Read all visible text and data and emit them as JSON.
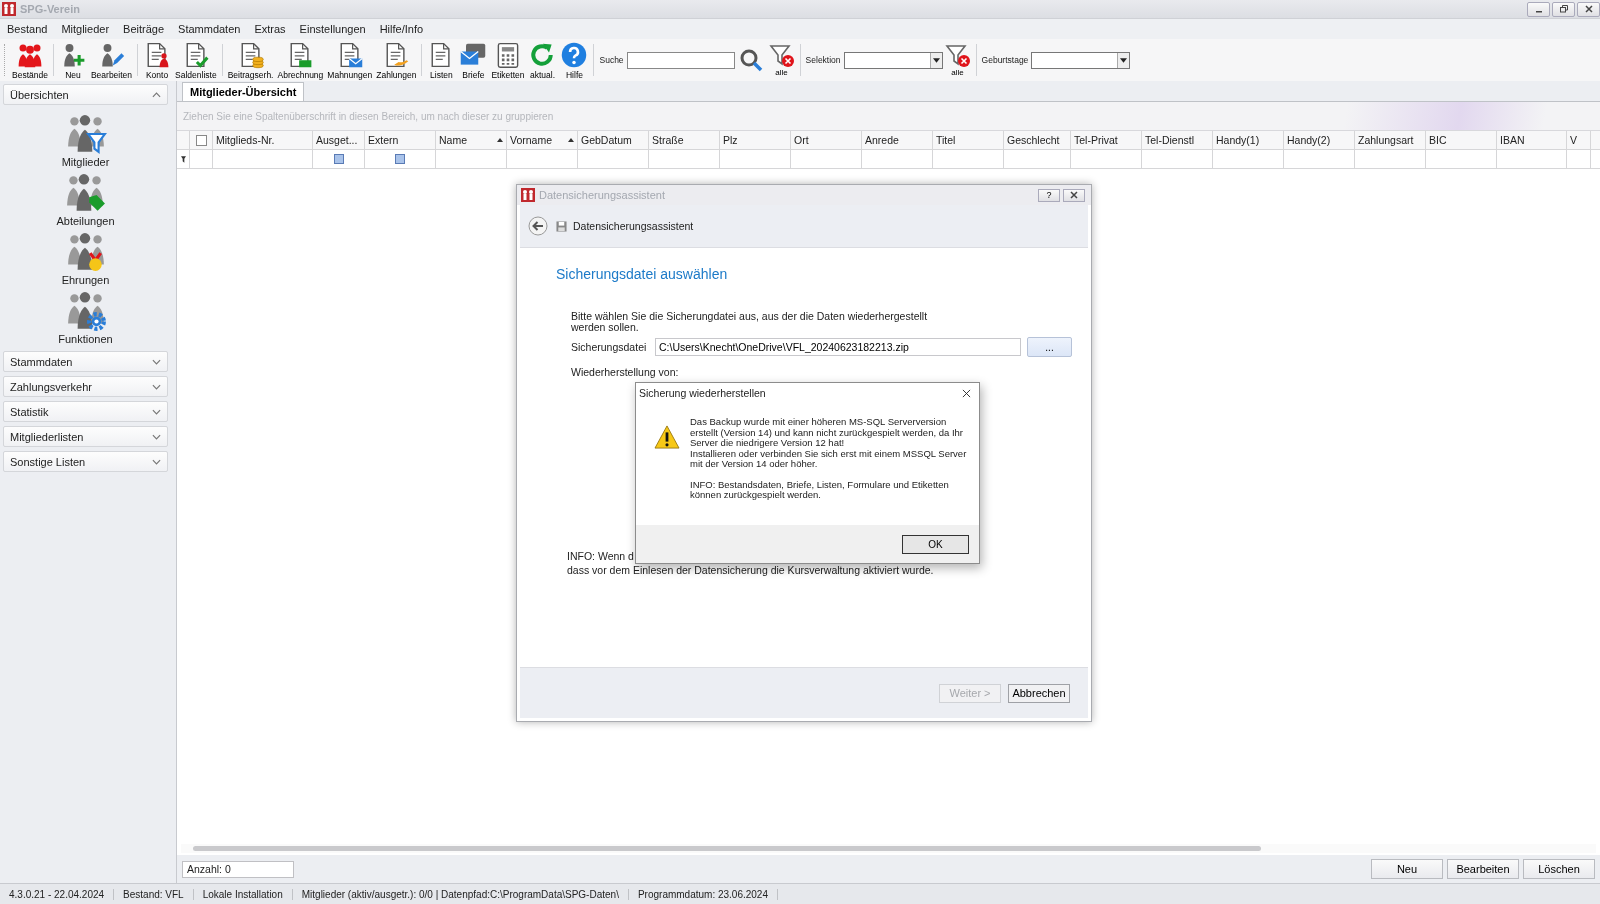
{
  "window": {
    "title": "SPG-Verein"
  },
  "menu": [
    "Bestand",
    "Mitglieder",
    "Beiträge",
    "Stammdaten",
    "Extras",
    "Einstellungen",
    "Hilfe/Info"
  ],
  "toolbar": {
    "groups": [
      [
        {
          "label": "Bestände",
          "kind": "pawns"
        }
      ],
      [
        {
          "label": "Neu",
          "kind": "person-plus"
        },
        {
          "label": "Bearbeiten",
          "kind": "person-pen"
        }
      ],
      [
        {
          "label": "Konto",
          "kind": "doc-person"
        },
        {
          "label": "Saldenliste",
          "kind": "doc-check"
        }
      ],
      [
        {
          "label": "Beitragserh.",
          "kind": "doc-coins"
        },
        {
          "label": "Abrechnung",
          "kind": "doc-list"
        },
        {
          "label": "Mahnungen",
          "kind": "doc-mail"
        },
        {
          "label": "Zahlungen",
          "kind": "doc-hand"
        }
      ],
      [
        {
          "label": "Listen",
          "kind": "doc"
        },
        {
          "label": "Briefe",
          "kind": "mail"
        },
        {
          "label": "Etiketten",
          "kind": "grid"
        },
        {
          "label": "aktual.",
          "kind": "refresh"
        },
        {
          "label": "Hilfe",
          "kind": "help"
        }
      ]
    ],
    "search_label": "Suche",
    "search_reset_label": "alle",
    "selection_label": "Selektion",
    "selection_reset_label": "alle",
    "birthdays_label": "Geburtstage"
  },
  "sidebar": {
    "sections": [
      {
        "title": "Übersichten",
        "expanded": true,
        "items": [
          {
            "label": "Mitglieder",
            "kind": "filter"
          },
          {
            "label": "Abteilungen",
            "kind": "tag"
          },
          {
            "label": "Ehrungen",
            "kind": "medal"
          },
          {
            "label": "Funktionen",
            "kind": "gear"
          }
        ]
      },
      {
        "title": "Stammdaten",
        "expanded": false
      },
      {
        "title": "Zahlungsverkehr",
        "expanded": false
      },
      {
        "title": "Statistik",
        "expanded": false
      },
      {
        "title": "Mitgliederlisten",
        "expanded": false
      },
      {
        "title": "Sonstige Listen",
        "expanded": false
      }
    ]
  },
  "tabs": [
    {
      "label": "Mitglieder-Übersicht",
      "selected": true
    }
  ],
  "grid": {
    "group_hint": "Ziehen Sie eine Spaltenüberschrift in diesen Bereich, um nach dieser zu gruppieren",
    "select_all_checked": false,
    "columns": [
      {
        "label": "Mitglieds-Nr.",
        "sorted": false,
        "filter_checkbox": false
      },
      {
        "label": "Ausget...",
        "sorted": false,
        "filter_checkbox": true
      },
      {
        "label": "Extern",
        "sorted": false,
        "filter_checkbox": true
      },
      {
        "label": "Name",
        "sorted": true,
        "filter_checkbox": false
      },
      {
        "label": "Vorname",
        "sorted": true,
        "filter_checkbox": false
      },
      {
        "label": "GebDatum",
        "sorted": false,
        "filter_checkbox": false
      },
      {
        "label": "Straße",
        "sorted": false,
        "filter_checkbox": false
      },
      {
        "label": "Plz",
        "sorted": false,
        "filter_checkbox": false
      },
      {
        "label": "Ort",
        "sorted": false,
        "filter_checkbox": false
      },
      {
        "label": "Anrede",
        "sorted": false,
        "filter_checkbox": false
      },
      {
        "label": "Titel",
        "sorted": false,
        "filter_checkbox": false
      },
      {
        "label": "Geschlecht",
        "sorted": false,
        "filter_checkbox": false
      },
      {
        "label": "Tel-Privat",
        "sorted": false,
        "filter_checkbox": false
      },
      {
        "label": "Tel-Dienstl",
        "sorted": false,
        "filter_checkbox": false
      },
      {
        "label": "Handy(1)",
        "sorted": false,
        "filter_checkbox": false
      },
      {
        "label": "Handy(2)",
        "sorted": false,
        "filter_checkbox": false
      },
      {
        "label": "Zahlungsart",
        "sorted": false,
        "filter_checkbox": false
      },
      {
        "label": "BIC",
        "sorted": false,
        "filter_checkbox": false
      },
      {
        "label": "IBAN",
        "sorted": false,
        "filter_checkbox": false
      },
      {
        "label": "V",
        "sorted": false,
        "filter_checkbox": false
      }
    ]
  },
  "count": "Anzahl: 0",
  "actions": [
    "Neu",
    "Bearbeiten",
    "Löschen"
  ],
  "status_bar": [
    "4.3.0.21 - 22.04.2024",
    "Bestand: VFL",
    "Lokale Installation",
    "Mitglieder (aktiv/ausgetr.): 0/0 | Datenpfad:C:\\ProgramData\\SPG-Daten\\",
    "Programmdatum: 23.06.2024"
  ],
  "wizard": {
    "title": "Datensicherungsassistent",
    "help_button": "?",
    "header": "Datensicherungsassistent",
    "heading": "Sicherungsdatei auswählen",
    "description": "Bitte wählen Sie die Sicherungdatei aus, aus der die Daten wiederhergestellt werden sollen.",
    "file_label": "Sicherungsdatei",
    "file_value": "C:\\Users\\Knecht\\OneDrive\\VFL_20240623182213.zip",
    "browse": "...",
    "restore_label": "Wiederherstellung von:",
    "info_line_1": "INFO: Wenn d",
    "info_line_2": "dass vor dem Einlesen der Datensicherung die Kursverwaltung aktiviert wurde.",
    "buttons": [
      {
        "label": "Weiter >",
        "disabled": true
      },
      {
        "label": "Abbrechen",
        "disabled": false
      }
    ]
  },
  "message_box": {
    "title": "Sicherung wiederherstellen",
    "paragraphs": [
      "Das Backup wurde mit einer höheren MS-SQL Serverversion erstellt (Version 14) und kann nicht zurückgespielt werden, da Ihr Server die niedrigere Version 12 hat!",
      "Installieren oder verbinden Sie sich erst mit einem MSSQL Server mit der Version 14 oder höher.",
      "INFO: Bestandsdaten, Briefe, Listen, Formulare und Etiketten können zurückgespielt werden."
    ],
    "button": "OK"
  }
}
